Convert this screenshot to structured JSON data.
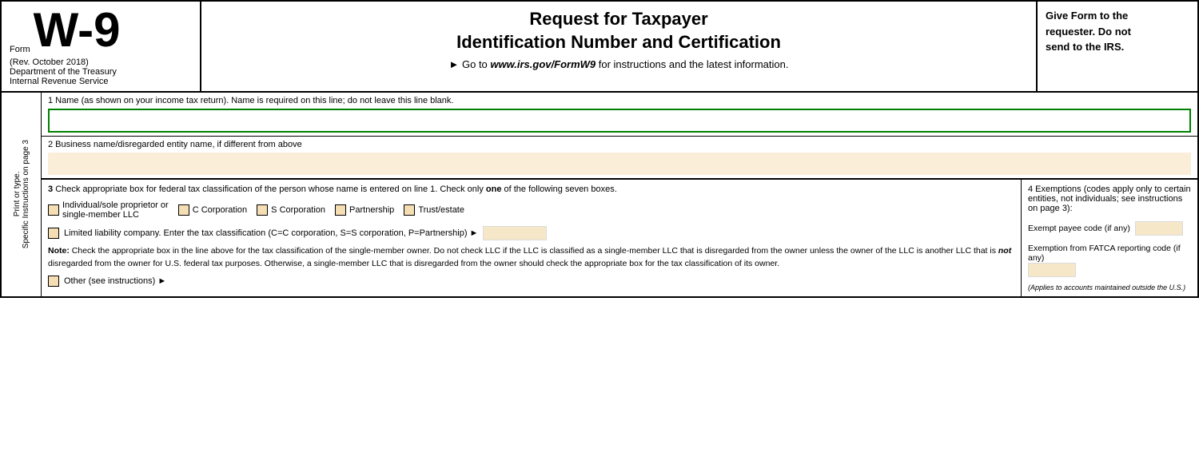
{
  "header": {
    "form_label": "Form",
    "form_number": "W-9",
    "rev_date": "(Rev. October 2018)",
    "department": "Department of the Treasury",
    "irs": "Internal Revenue Service",
    "main_title_line1": "Request for Taxpayer",
    "main_title_line2": "Identification Number and Certification",
    "go_to": "► Go to",
    "url": "www.irs.gov/FormW9",
    "for_instructions": "for instructions and the latest information.",
    "right_text_line1": "Give Form to the",
    "right_text_line2": "requester. Do not",
    "right_text_line3": "send to the IRS."
  },
  "line1": {
    "label": "1  Name (as shown on your income tax return). Name is required on this line; do not leave this line blank."
  },
  "line2": {
    "label": "2  Business name/disregarded entity name, if different from above"
  },
  "line3": {
    "label_prefix": "3",
    "label": " Check appropriate box for federal tax classification of the person whose name is entered on line 1. Check only ",
    "label_bold": "one",
    "label_suffix": " of the following seven boxes.",
    "checkboxes": [
      {
        "id": "cb1",
        "label": "Individual/sole proprietor or\nsingle-member LLC"
      },
      {
        "id": "cb2",
        "label": "C Corporation"
      },
      {
        "id": "cb3",
        "label": "S Corporation"
      },
      {
        "id": "cb4",
        "label": "Partnership"
      },
      {
        "id": "cb5",
        "label": "Trust/estate"
      }
    ],
    "llc_text": "Limited liability company. Enter the tax classification (C=C corporation, S=S corporation, P=Partnership) ►",
    "note_bold": "Note:",
    "note_text": " Check the appropriate box in the line above for the tax classification of the single-member owner.  Do not check LLC if the LLC is classified as a single-member LLC that is disregarded from the owner unless the owner of the LLC is another LLC that is ",
    "note_not": "not",
    "note_text2": " disregarded from the owner for U.S. federal tax purposes. Otherwise, a single-member LLC that is disregarded from the owner should check the appropriate box for the tax classification of its owner.",
    "other_text": "Other (see instructions) ►"
  },
  "line4": {
    "header": "4  Exemptions (codes apply only to certain entities, not individuals; see instructions on page 3):",
    "exempt_label": "Exempt payee code (if any)",
    "fatca_label": "Exemption from FATCA reporting code (if any)",
    "applies_text": "(Applies to accounts maintained outside the U.S.)"
  },
  "side_label": {
    "text": "Print or type.     Specific Instructions on page 3"
  }
}
